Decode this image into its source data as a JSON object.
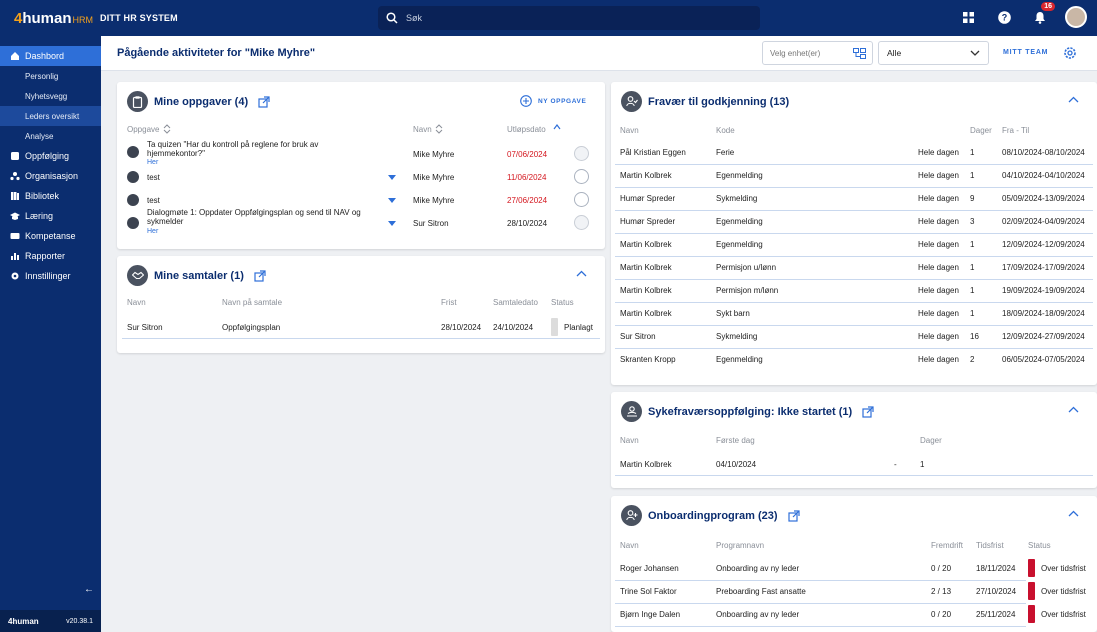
{
  "app": {
    "logo_prefix": "4",
    "logo_name": "human",
    "logo_suffix": "HRM",
    "system_name": "DITT HR SYSTEM",
    "version": "v20.38.1",
    "footer_brand": "4human"
  },
  "search": {
    "placeholder": "Søk"
  },
  "notifications": {
    "count": "16"
  },
  "sidebar": {
    "items": [
      {
        "label": "Dashbord",
        "icon": "home-icon"
      },
      {
        "label": "Personlig"
      },
      {
        "label": "Nyhetsvegg"
      },
      {
        "label": "Leders oversikt"
      },
      {
        "label": "Analyse"
      },
      {
        "label": "Oppfølging",
        "icon": "follow-up-icon"
      },
      {
        "label": "Organisasjon",
        "icon": "organization-icon"
      },
      {
        "label": "Bibliotek",
        "icon": "library-icon"
      },
      {
        "label": "Læring",
        "icon": "learning-icon"
      },
      {
        "label": "Kompetanse",
        "icon": "competence-icon"
      },
      {
        "label": "Rapporter",
        "icon": "reports-icon"
      },
      {
        "label": "Innstillinger",
        "icon": "settings-icon"
      }
    ]
  },
  "header": {
    "title": "Pågående aktiviteter for \"Mike Myhre\"",
    "unit_placeholder": "Velg enhet(er)",
    "filter_value": "Alle",
    "team_button": "MITT TEAM"
  },
  "tasks": {
    "title": "Mine oppgaver (4)",
    "new_button": "NY OPPGAVE",
    "columns": [
      "Oppgave",
      "Navn",
      "Utløpsdato"
    ],
    "rows": [
      {
        "task": "Ta quizen \"Har du kontroll på reglene for bruk av hjemmekontor?\"",
        "more": "Her",
        "name": "Mike Myhre",
        "date": "07/06/2024",
        "overdue": true
      },
      {
        "task": "test",
        "more": "",
        "name": "Mike Myhre",
        "date": "11/06/2024",
        "overdue": true
      },
      {
        "task": "test",
        "more": "",
        "name": "Mike Myhre",
        "date": "27/06/2024",
        "overdue": true
      },
      {
        "task": "Dialogmøte 1: Oppdater Oppfølgingsplan og send til NAV og sykmelder",
        "more": "Her",
        "name": "Sur Sitron",
        "date": "28/10/2024",
        "overdue": false
      }
    ]
  },
  "talks": {
    "title": "Mine samtaler (1)",
    "columns": [
      "Navn",
      "Navn på samtale",
      "Frist",
      "Samtaledato",
      "Status"
    ],
    "rows": [
      {
        "name": "Sur Sitron",
        "talk": "Oppfølgingsplan",
        "deadline": "28/10/2024",
        "date": "24/10/2024",
        "status": "Planlagt"
      }
    ]
  },
  "absence": {
    "title": "Fravær til godkjenning (13)",
    "columns": [
      "Navn",
      "Kode",
      "Dager",
      "Fra - Til"
    ],
    "rows": [
      {
        "name": "Pål Kristian Eggen",
        "code": "Ferie",
        "type": "Hele dagen",
        "days": "1",
        "range": "08/10/2024-08/10/2024"
      },
      {
        "name": "Martin Kolbrek",
        "code": "Egenmelding",
        "type": "Hele dagen",
        "days": "1",
        "range": "04/10/2024-04/10/2024"
      },
      {
        "name": "Humør Spreder",
        "code": "Sykmelding",
        "type": "Hele dagen",
        "days": "9",
        "range": "05/09/2024-13/09/2024"
      },
      {
        "name": "Humør Spreder",
        "code": "Egenmelding",
        "type": "Hele dagen",
        "days": "3",
        "range": "02/09/2024-04/09/2024"
      },
      {
        "name": "Martin Kolbrek",
        "code": "Egenmelding",
        "type": "Hele dagen",
        "days": "1",
        "range": "12/09/2024-12/09/2024"
      },
      {
        "name": "Martin Kolbrek",
        "code": "Permisjon u/lønn",
        "type": "Hele dagen",
        "days": "1",
        "range": "17/09/2024-17/09/2024"
      },
      {
        "name": "Martin Kolbrek",
        "code": "Permisjon m/lønn",
        "type": "Hele dagen",
        "days": "1",
        "range": "19/09/2024-19/09/2024"
      },
      {
        "name": "Martin Kolbrek",
        "code": "Sykt barn",
        "type": "Hele dagen",
        "days": "1",
        "range": "18/09/2024-18/09/2024"
      },
      {
        "name": "Sur Sitron",
        "code": "Sykmelding",
        "type": "Hele dagen",
        "days": "16",
        "range": "12/09/2024-27/09/2024"
      },
      {
        "name": "Skranten Kropp",
        "code": "Egenmelding",
        "type": "Hele dagen",
        "days": "2",
        "range": "06/05/2024-07/05/2024"
      }
    ]
  },
  "sickfollow": {
    "title": "Sykefraværsoppfølging: Ikke startet (1)",
    "columns": [
      "Navn",
      "Første dag",
      "Dager"
    ],
    "rows": [
      {
        "name": "Martin Kolbrek",
        "first_day": "04/10/2024",
        "dash": "-",
        "days": "1"
      }
    ]
  },
  "onboarding": {
    "title": "Onboardingprogram (23)",
    "columns": [
      "Navn",
      "Programnavn",
      "Fremdrift",
      "Tidsfrist",
      "Status"
    ],
    "rows": [
      {
        "name": "Roger Johansen",
        "program": "Onboarding av ny leder",
        "progress": "0 / 20",
        "deadline": "18/11/2024",
        "status": "Over tidsfrist"
      },
      {
        "name": "Trine Sol Faktor",
        "program": "Preboarding Fast ansatte",
        "progress": "2 / 13",
        "deadline": "27/10/2024",
        "status": "Over tidsfrist"
      },
      {
        "name": "Bjørn Inge Dalen",
        "program": "Onboarding av ny leder",
        "progress": "0 / 20",
        "deadline": "25/11/2024",
        "status": "Over tidsfrist"
      }
    ]
  },
  "colors": {
    "brand": "#0b2d6f",
    "accent": "#2e6fd8",
    "danger": "#d4161e"
  }
}
